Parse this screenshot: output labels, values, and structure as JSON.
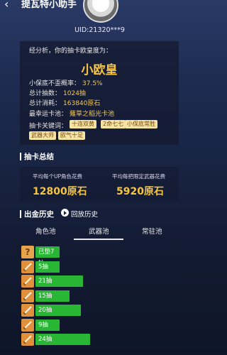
{
  "header": {
    "title": "提瓦特小助手",
    "back_icon": "back-arrow-icon"
  },
  "profile": {
    "uid": "UID:21320***9"
  },
  "analysis": {
    "intro": "经分析，你的抽卡欧皇度为：",
    "level": "小欧皇",
    "stats": [
      {
        "label": "小保底不歪概率：",
        "value": "37.5%"
      },
      {
        "label": "总计抽数：",
        "value": "1024抽"
      },
      {
        "label": "总计消耗：",
        "value": "163840原石"
      },
      {
        "label": "最幸运卡池：",
        "value": "薙草之稻光卡池"
      }
    ],
    "keywords_label": "抽卡关键词：",
    "keywords": [
      "十连双黄",
      "2命七七",
      "小保底常胜",
      "武器大师",
      "欧气十足"
    ]
  },
  "summary": {
    "title": "抽卡总结",
    "avg_up_label": "平均每个UP角色花费",
    "avg_up_value": "12800原石",
    "avg_weapon_label": "平均每把限定武器花费",
    "avg_weapon_value": "5920原石"
  },
  "history": {
    "title": "出金历史",
    "replay_label": "回放历史",
    "tabs": [
      "角色池",
      "武器池",
      "常驻池"
    ],
    "active_tab": "武器池",
    "rows": [
      {
        "label": "已垫7抽",
        "icon": "question-icon",
        "fill": 0.07
      },
      {
        "label": "5抽",
        "icon": "weapon-icon",
        "fill": 0.05
      },
      {
        "label": "21抽",
        "icon": "weapon-icon",
        "fill": 0.21
      },
      {
        "label": "15抽",
        "icon": "weapon-icon",
        "fill": 0.15
      },
      {
        "label": "20抽",
        "icon": "weapon-icon",
        "fill": 0.2
      },
      {
        "label": "9抽",
        "icon": "weapon-icon",
        "fill": 0.09
      },
      {
        "label": "24抽",
        "icon": "weapon-icon",
        "fill": 0.24
      }
    ]
  },
  "colors": {
    "accent_gold": "#f7c544",
    "bar_green": "#28b634",
    "tag_bg": "#f4e3a2"
  }
}
